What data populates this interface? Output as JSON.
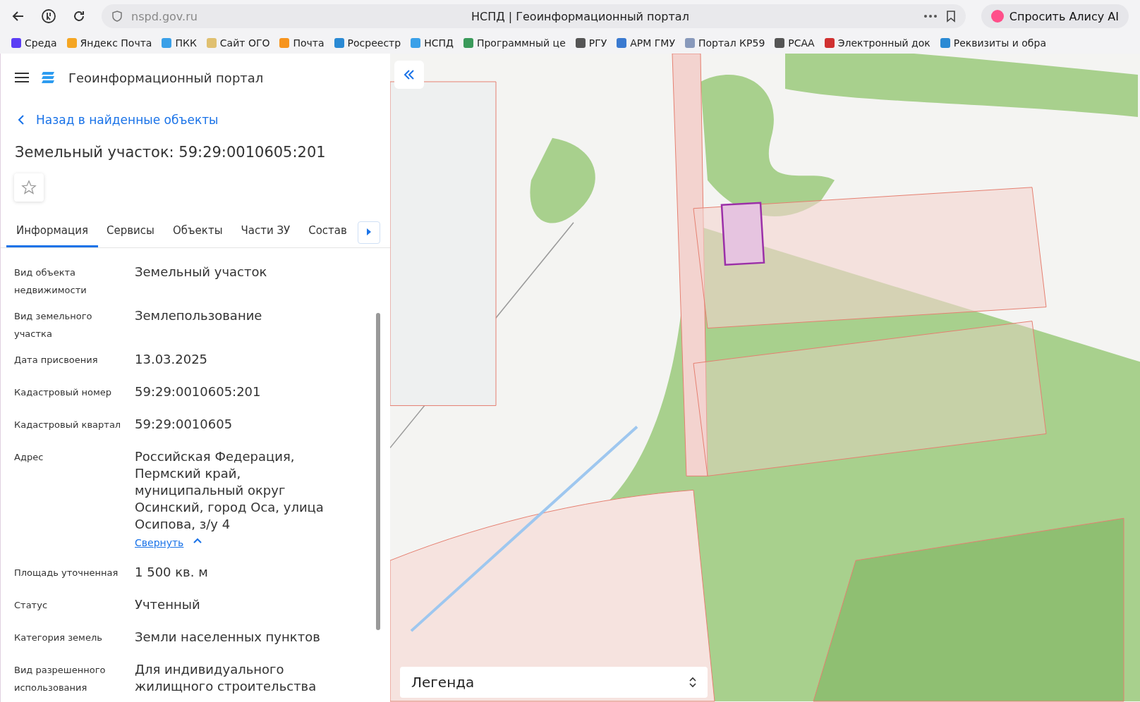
{
  "browser": {
    "url": "nspd.gov.ru",
    "title": "НСПД | Геоинформационный портал",
    "alice_button": "Спросить Алису AI",
    "bookmarks": [
      {
        "label": "Среда",
        "color": "#5b3df5"
      },
      {
        "label": "Яндекс Почта",
        "color": "#f5a623"
      },
      {
        "label": "ПКК",
        "color": "#3aa0e8"
      },
      {
        "label": "Сайт ОГО",
        "color": "#e0c070"
      },
      {
        "label": "Почта",
        "color": "#f7941d"
      },
      {
        "label": "Росреестр",
        "color": "#2a8ad4"
      },
      {
        "label": "НСПД",
        "color": "#3aa0e8"
      },
      {
        "label": "Программный це",
        "color": "#3a9a5a"
      },
      {
        "label": "РГУ",
        "color": "#555555"
      },
      {
        "label": "АРМ ГМУ",
        "color": "#3a7ad0"
      },
      {
        "label": "Портал КР59",
        "color": "#8899bb"
      },
      {
        "label": "РСАА",
        "color": "#555555"
      },
      {
        "label": "Электронный док",
        "color": "#d03030"
      },
      {
        "label": "Реквизиты и обра",
        "color": "#2a8ad4"
      }
    ]
  },
  "panel": {
    "app_title": "Геоинформационный портал",
    "back_link": "Назад в найденные объекты",
    "heading": "Земельный участок: 59:29:0010605:201",
    "favorite": false,
    "tabs": [
      {
        "label": "Информация",
        "selected": true
      },
      {
        "label": "Сервисы",
        "selected": false
      },
      {
        "label": "Объекты",
        "selected": false
      },
      {
        "label": "Части ЗУ",
        "selected": false
      },
      {
        "label": "Состав",
        "selected": false
      }
    ],
    "fields": [
      {
        "label": "Вид объекта недвижимости",
        "value": "Земельный участок"
      },
      {
        "label": "Вид земельного участка",
        "value": "Землепользование"
      },
      {
        "label": "Дата присвоения",
        "value": "13.03.2025"
      },
      {
        "label": "Кадастровый номер",
        "value": "59:29:0010605:201"
      },
      {
        "label": "Кадастровый квартал",
        "value": "59:29:0010605"
      },
      {
        "label": "Адрес",
        "value": "Российская Федерация, Пермский край, муниципальный округ Осинский, город Оса, улица Осипова, з/у 4",
        "collapse_link": "Свернуть"
      },
      {
        "label": "Площадь уточненная",
        "value": "1 500 кв. м"
      },
      {
        "label": "Статус",
        "value": "Учтенный"
      },
      {
        "label": "Категория земель",
        "value": "Земли населенных пунктов"
      },
      {
        "label": "Вид разрешенного использования",
        "value": "Для индивидуального жилищного строительства"
      }
    ]
  },
  "map": {
    "legend": "Легенда"
  }
}
